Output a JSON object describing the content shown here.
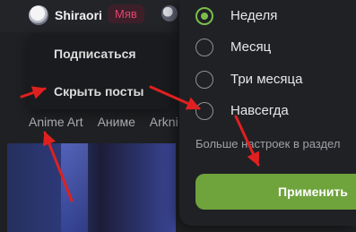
{
  "header": {
    "username": "Shiraori",
    "tag": "Мяв",
    "avatar_icon": "avatar",
    "secondary_icon": "moon-icon"
  },
  "dropdown_menu": {
    "items": [
      {
        "label": "Подписаться"
      },
      {
        "label": "Скрыть посты"
      }
    ]
  },
  "tags": [
    "Anime Art",
    "Аниме",
    "Arkni"
  ],
  "period_panel": {
    "options": [
      {
        "label": "Неделя",
        "selected": true
      },
      {
        "label": "Месяц",
        "selected": false
      },
      {
        "label": "Три месяца",
        "selected": false
      },
      {
        "label": "Навсегда",
        "selected": false
      }
    ],
    "more_settings": "Больше настроек в раздел",
    "apply_label": "Применить"
  },
  "colors": {
    "accent": "#6fa33c",
    "radio_selected": "#7bbd4a",
    "tag_text": "#e0456e",
    "arrow": "#e02020"
  }
}
